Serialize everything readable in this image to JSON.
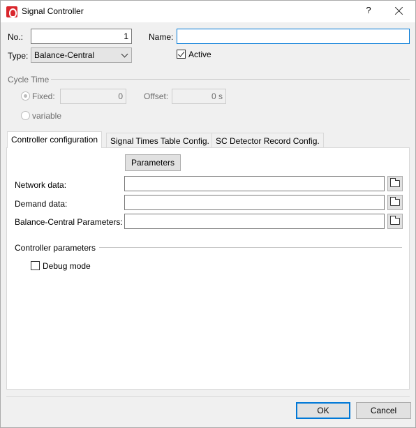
{
  "window": {
    "title": "Signal Controller",
    "help_label": "?"
  },
  "form": {
    "no_label": "No.:",
    "no_value": "1",
    "name_label": "Name:",
    "name_value": "",
    "type_label": "Type:",
    "type_value": "Balance-Central",
    "active_label": "Active",
    "active_checked": true
  },
  "cycle_time": {
    "header": "Cycle Time",
    "fixed_label": "Fixed:",
    "fixed_value": "0",
    "offset_label": "Offset:",
    "offset_value": "0 s",
    "variable_label": "variable"
  },
  "tabs": [
    {
      "label": "Controller configuration"
    },
    {
      "label": "Signal Times Table Config."
    },
    {
      "label": "SC Detector Record Config."
    }
  ],
  "controller_config": {
    "parameters_button": "Parameters",
    "network_data_label": "Network data:",
    "demand_data_label": "Demand data:",
    "balance_params_label": "Balance-Central Parameters:",
    "controller_params_header": "Controller parameters",
    "debug_mode_label": "Debug mode",
    "debug_mode_checked": false
  },
  "footer": {
    "ok_label": "OK",
    "cancel_label": "Cancel"
  },
  "colors": {
    "accent": "#0078d7",
    "app_icon": "#d9262c"
  }
}
